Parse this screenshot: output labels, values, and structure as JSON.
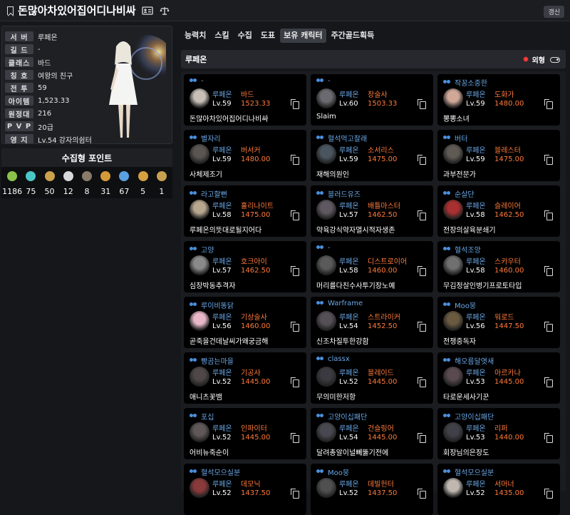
{
  "header": {
    "title": "돈많아차있어집어디나비싸",
    "refresh_label": "갱신"
  },
  "profile": {
    "rows": [
      {
        "label": "서 버",
        "value": "루페온"
      },
      {
        "label": "길 드",
        "value": "-"
      },
      {
        "label": "클래스",
        "value": "바드"
      },
      {
        "label": "칭 호",
        "value": "여왕의 친구"
      },
      {
        "label": "전 투",
        "value": "59"
      },
      {
        "label": "아이템",
        "value": "1,523.33"
      },
      {
        "label": "원정대",
        "value": "216"
      },
      {
        "label": "P V P",
        "value": "20급"
      },
      {
        "label": "영 지",
        "value": "Lv.54 강자의쉼터"
      }
    ]
  },
  "collect": {
    "title": "수집형 포인트",
    "items": [
      {
        "icon": "seed-icon",
        "color": "#8bc34a",
        "value": "1186"
      },
      {
        "icon": "island-heart-icon",
        "color": "#4ac6c6",
        "value": "75"
      },
      {
        "icon": "painting-icon",
        "color": "#c9a24a",
        "value": "50"
      },
      {
        "icon": "mokoko-icon",
        "color": "#d8d8d8",
        "value": "12"
      },
      {
        "icon": "giant-heart-icon",
        "color": "#8a7a6a",
        "value": "8"
      },
      {
        "icon": "ignea-icon",
        "color": "#d49a3a",
        "value": "31"
      },
      {
        "icon": "orpheus-star-icon",
        "color": "#5aa0e0",
        "value": "67"
      },
      {
        "icon": "world-tree-icon",
        "color": "#d4a040",
        "value": "5"
      },
      {
        "icon": "sea-bounty-icon",
        "color": "#c8a050",
        "value": "1"
      }
    ]
  },
  "tabs": [
    "능력치",
    "스킬",
    "수집",
    "도표",
    "보유 캐릭터",
    "주간골드획득"
  ],
  "active_tab": 4,
  "server_bar": {
    "name": "루페온",
    "toggle_label": "외형"
  },
  "characters": [
    {
      "guild": "-",
      "server": "루페온",
      "class": "바드",
      "level": "Lv.59",
      "ilvl": "1523.33",
      "name": "돈많아차있어집어디나비싸",
      "avatar": "#c8c0b8"
    },
    {
      "guild": "-",
      "server": "루페온",
      "class": "창술사",
      "level": "Lv.60",
      "ilvl": "1503.33",
      "name": "Slaim",
      "avatar": "#6a6a70"
    },
    {
      "guild": "작꽁소중한",
      "server": "루페온",
      "class": "도화가",
      "level": "Lv.59",
      "ilvl": "1480.00",
      "name": "뽕뽕소녀",
      "avatar": "#d0a898"
    },
    {
      "guild": "별자리",
      "server": "루페온",
      "class": "버서커",
      "level": "Lv.59",
      "ilvl": "1480.00",
      "name": "사체제조기",
      "avatar": "#5a5550"
    },
    {
      "guild": "혈석먹고찰래",
      "server": "루페온",
      "class": "소서리스",
      "level": "Lv.59",
      "ilvl": "1475.00",
      "name": "재해의원인",
      "avatar": "#4a5560"
    },
    {
      "guild": "버터",
      "server": "루페온",
      "class": "블레스터",
      "level": "Lv.59",
      "ilvl": "1475.00",
      "name": "과부전문가",
      "avatar": "#605a55"
    },
    {
      "guild": "라고할뻔",
      "server": "루페온",
      "class": "홀리나이트",
      "level": "Lv.58",
      "ilvl": "1475.00",
      "name": "루페온의뜻대로될지어다",
      "avatar": "#b8a890"
    },
    {
      "guild": "블러드유즈",
      "server": "루페온",
      "class": "배틀마스터",
      "level": "Lv.57",
      "ilvl": "1462.50",
      "name": "약육강식약자멸시적자생존",
      "avatar": "#605860"
    },
    {
      "guild": "순살단",
      "server": "루페온",
      "class": "슬레이어",
      "level": "Lv.58",
      "ilvl": "1462.50",
      "name": "전장의살육분쇄기",
      "avatar": "#a83030"
    },
    {
      "guild": "고양",
      "server": "루페온",
      "class": "호크아이",
      "level": "Lv.57",
      "ilvl": "1462.50",
      "name": "심장박동추격자",
      "avatar": "#8a8a8a"
    },
    {
      "guild": "-",
      "server": "루페온",
      "class": "디스트로이어",
      "level": "Lv.58",
      "ilvl": "1460.00",
      "name": "머리를다친수사투기장노예",
      "avatar": "#5a5a5a"
    },
    {
      "guild": "혈석조앙",
      "server": "루페온",
      "class": "스카우터",
      "level": "Lv.58",
      "ilvl": "1460.00",
      "name": "무김정살인병기프로토타입",
      "avatar": "#707070"
    },
    {
      "guild": "루이비똥닭",
      "server": "루페온",
      "class": "기상술사",
      "level": "Lv.56",
      "ilvl": "1460.00",
      "name": "곧죽을건데날씨가왜궁금해",
      "avatar": "#e8b8c8"
    },
    {
      "guild": "Warframe",
      "server": "루페온",
      "class": "스트라이커",
      "level": "Lv.54",
      "ilvl": "1452.50",
      "name": "신조차질투한강함",
      "avatar": "#555055"
    },
    {
      "guild": "Moo뭉",
      "server": "루페온",
      "class": "워로드",
      "level": "Lv.56",
      "ilvl": "1447.50",
      "name": "전쟁중독자",
      "avatar": "#6a5a40"
    },
    {
      "guild": "빵곰는마을",
      "server": "루페온",
      "class": "기공사",
      "level": "Lv.52",
      "ilvl": "1445.00",
      "name": "애니츠꽃뱀",
      "avatar": "#504848"
    },
    {
      "guild": "classx",
      "server": "루페온",
      "class": "블레이드",
      "level": "Lv.52",
      "ilvl": "1445.00",
      "name": "무의미한저항",
      "avatar": "#3a3a40"
    },
    {
      "guild": "해오름달엿새",
      "server": "루페온",
      "class": "아르카나",
      "level": "Lv.53",
      "ilvl": "1445.00",
      "name": "타로운세사기꾼",
      "avatar": "#5a4a50"
    },
    {
      "guild": "포십",
      "server": "루페온",
      "class": "인파이터",
      "level": "Lv.52",
      "ilvl": "1445.00",
      "name": "어비뉴죽순이",
      "avatar": "#605858"
    },
    {
      "guild": "고양이십패단",
      "server": "루페온",
      "class": "건슬링어",
      "level": "Lv.54",
      "ilvl": "1445.00",
      "name": "달려총알이널뻬뚫기전에",
      "avatar": "#484850"
    },
    {
      "guild": "고양이십패단",
      "server": "루페온",
      "class": "리퍼",
      "level": "Lv.53",
      "ilvl": "1440.00",
      "name": "회장님의은장도",
      "avatar": "#404048"
    },
    {
      "guild": "혈석모으실분",
      "server": "루페온",
      "class": "데모닉",
      "level": "Lv.52",
      "ilvl": "1437.50",
      "name": "",
      "avatar": "#8a3a3a"
    },
    {
      "guild": "Moo뭉",
      "server": "루페온",
      "class": "데빌헌터",
      "level": "Lv.52",
      "ilvl": "1437.50",
      "name": "",
      "avatar": "#505050"
    },
    {
      "guild": "혈석모으실분",
      "server": "루페온",
      "class": "서머너",
      "level": "Lv.52",
      "ilvl": "1435.00",
      "name": "",
      "avatar": "#c0b8b0"
    }
  ]
}
